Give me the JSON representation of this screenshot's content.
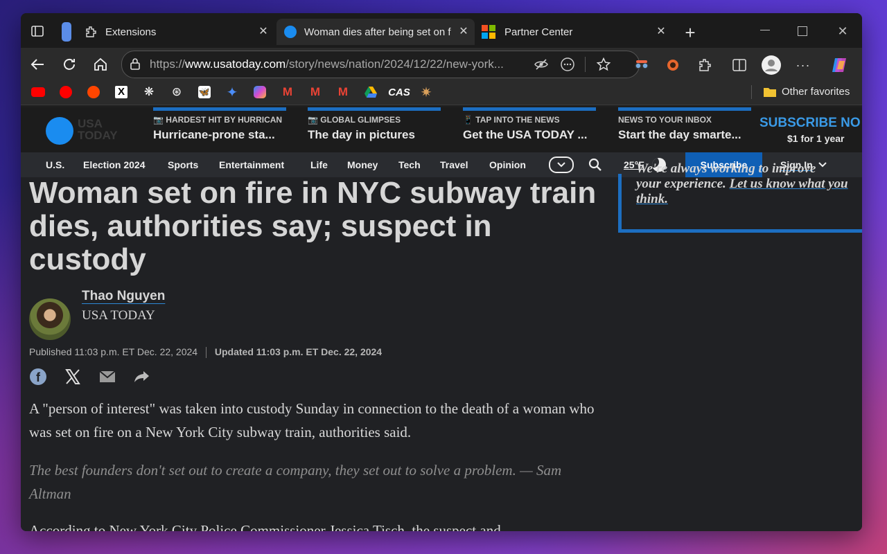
{
  "browser": {
    "tabs": [
      {
        "label": "Extensions"
      },
      {
        "label": "Woman dies after being set on f"
      },
      {
        "label": "Partner Center"
      }
    ],
    "url_prefix": "https://",
    "url_domain": "www.usatoday.com",
    "url_path": "/story/news/nation/2024/12/22/new-york...",
    "favorites_label": "Other favorites"
  },
  "site": {
    "logo_line1": "USA",
    "logo_line2": "TODAY",
    "promos": [
      {
        "kicker": "HARDEST HIT BY HURRICAN",
        "title": "Hurricane-prone sta..."
      },
      {
        "kicker": "GLOBAL GLIMPSES",
        "title": "The day in pictures"
      },
      {
        "kicker": "TAP INTO THE NEWS",
        "title": "Get the USA TODAY ..."
      },
      {
        "kicker": "NEWS TO YOUR INBOX",
        "title": "Start the day smarte..."
      }
    ],
    "subscribe_promo": "SUBSCRIBE NO",
    "subscribe_price": "$1 for 1 year",
    "nav": [
      "U.S.",
      "Election 2024",
      "Sports",
      "Entertainment",
      "Life",
      "Money",
      "Tech",
      "Travel",
      "Opinion"
    ],
    "weather": "25°F",
    "subscribe_button": "Subscribe",
    "sign_in": "Sign In"
  },
  "article": {
    "headline": "Woman set on fire in NYC subway train dies, authorities say; suspect in custody",
    "author": "Thao Nguyen",
    "org": "USA TODAY",
    "published": "Published 11:03 p.m. ET Dec. 22, 2024",
    "updated": "Updated 11:03 p.m. ET Dec. 22, 2024",
    "para1": "A \"person of interest\" was taken into custody Sunday in connection to the death of a woman who was set on fire on a New York City subway train, authorities said.",
    "quote": "The best founders don't set out to create a company, they set out to solve a problem. — Sam Altman",
    "para2": "According to New York City Police Commissioner Jessica Tisch, the suspect and"
  },
  "sidebar": {
    "line1": "We're always working to improve",
    "line2": "your experience. ",
    "link": "Let us know what you think."
  }
}
